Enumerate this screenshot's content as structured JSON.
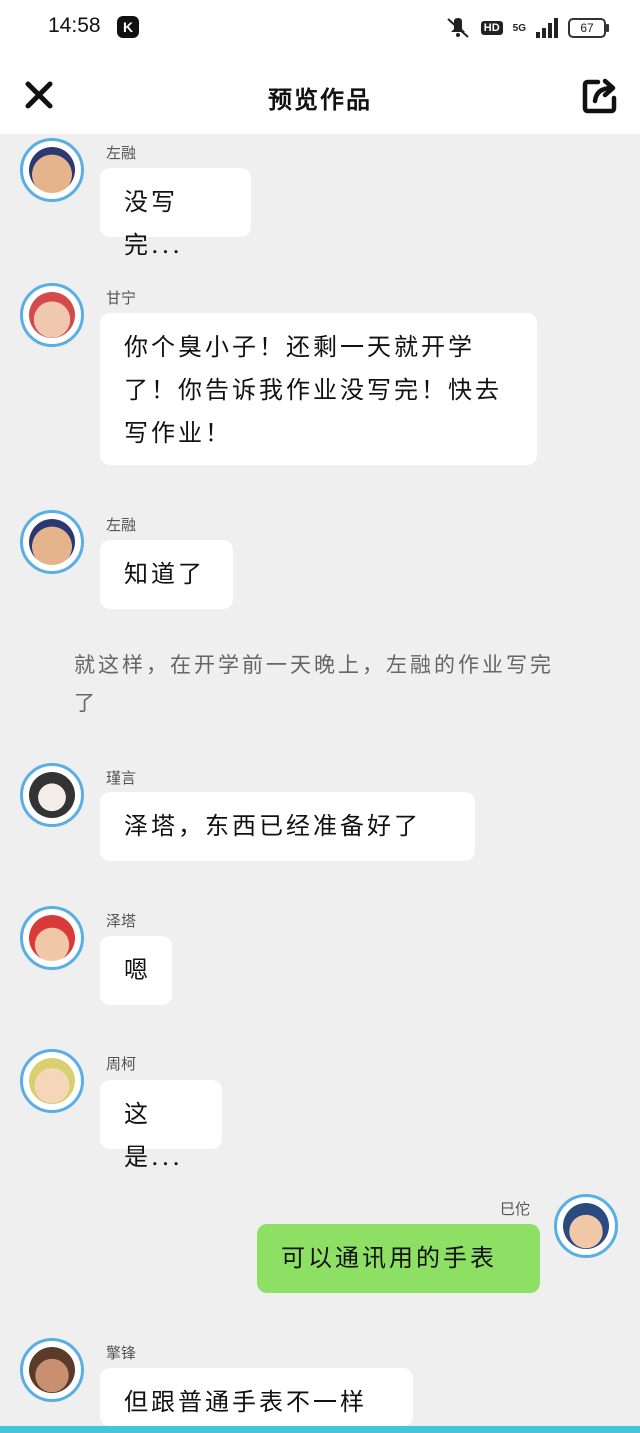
{
  "status_bar": {
    "time": "14:58",
    "app_badge": "K",
    "hd": "HD",
    "network": "5G",
    "battery": "67",
    "icons": [
      "mute-icon",
      "signal-icon",
      "battery-icon"
    ]
  },
  "header": {
    "title": "预览作品",
    "close_icon": "close-icon",
    "share_icon": "share-icon"
  },
  "messages": [
    {
      "name": "左融",
      "text": "没写完..."
    },
    {
      "name": "甘宁",
      "text": "你个臭小子！还剩一天就开学了！你告诉我作业没写完！快去写作业！"
    },
    {
      "name": "左融",
      "text": "知道了"
    },
    {
      "name": "瑾言",
      "text": "泽塔，东西已经准备好了"
    },
    {
      "name": "泽塔",
      "text": "嗯"
    },
    {
      "name": "周柯",
      "text": "这是..."
    },
    {
      "name": "巳佗",
      "text": "可以通讯用的手表"
    },
    {
      "name": "擎锋",
      "text": "但跟普通手表不一样"
    }
  ],
  "narration": "就这样，在开学前一天晚上，左融的作业写完了",
  "colors": {
    "avatar_border": "#5aaee6",
    "bubble_self": "#8ee064",
    "bubble_other": "#ffffff",
    "background": "#efefef",
    "bottom_bar": "#40c8d8"
  }
}
